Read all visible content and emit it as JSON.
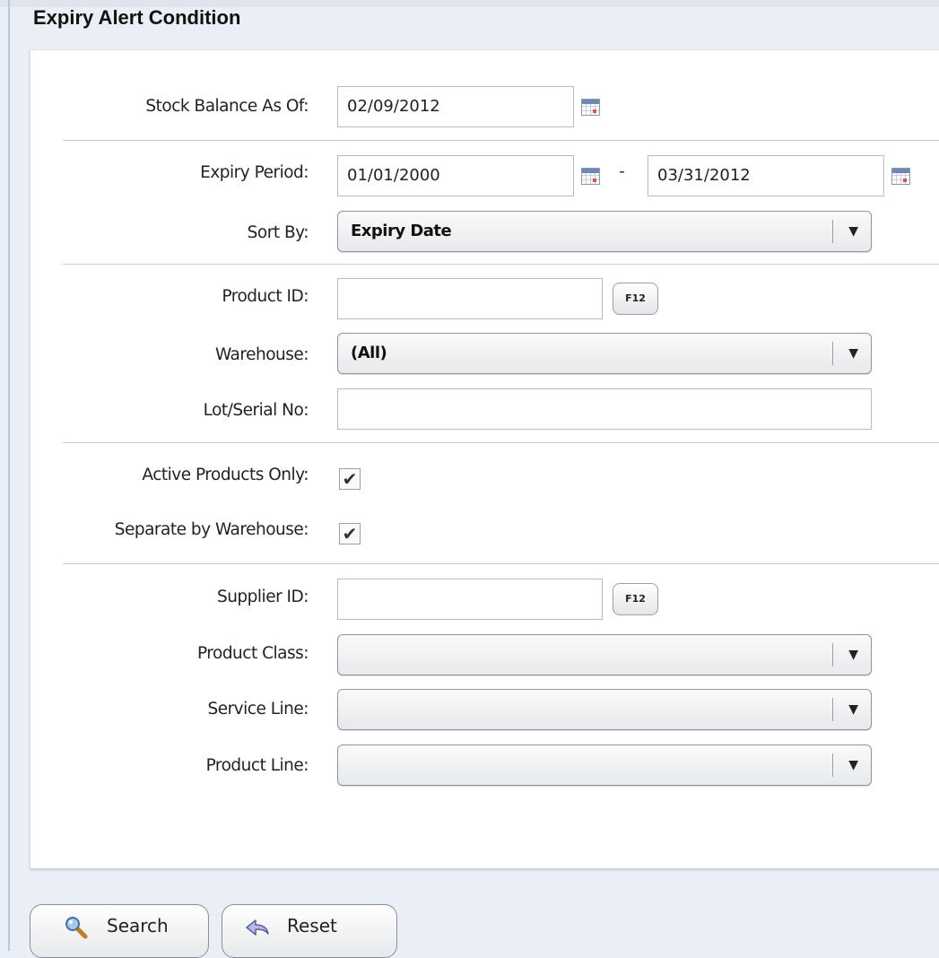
{
  "page": {
    "title": "Expiry Alert Condition"
  },
  "form": {
    "stock_balance_label": "Stock Balance As Of:",
    "stock_balance_value": "02/09/2012",
    "expiry_period_label": "Expiry Period:",
    "expiry_from_value": "01/01/2000",
    "expiry_separator": "-",
    "expiry_to_value": "03/31/2012",
    "sort_by_label": "Sort By:",
    "sort_by_value": "Expiry Date",
    "product_id_label": "Product ID:",
    "product_id_value": "",
    "product_lookup_label": "F12",
    "warehouse_label": "Warehouse:",
    "warehouse_value": "(All)",
    "lot_serial_label": "Lot/Serial No:",
    "lot_serial_value": "",
    "active_products_label": "Active Products Only:",
    "active_products_checked": true,
    "separate_warehouse_label": "Separate by Warehouse:",
    "separate_warehouse_checked": true,
    "supplier_id_label": "Supplier ID:",
    "supplier_id_value": "",
    "supplier_lookup_label": "F12",
    "product_class_label": "Product Class:",
    "product_class_value": "",
    "service_line_label": "Service Line:",
    "service_line_value": "",
    "product_line_label": "Product Line:",
    "product_line_value": ""
  },
  "actions": {
    "search_label": "Search",
    "reset_label": "Reset"
  },
  "icons": {
    "calendar": "calendar-icon",
    "dropdown": "chevron-down-icon",
    "checkmark": "✔",
    "search": "magnifier-icon",
    "reset": "undo-arrow-icon"
  }
}
